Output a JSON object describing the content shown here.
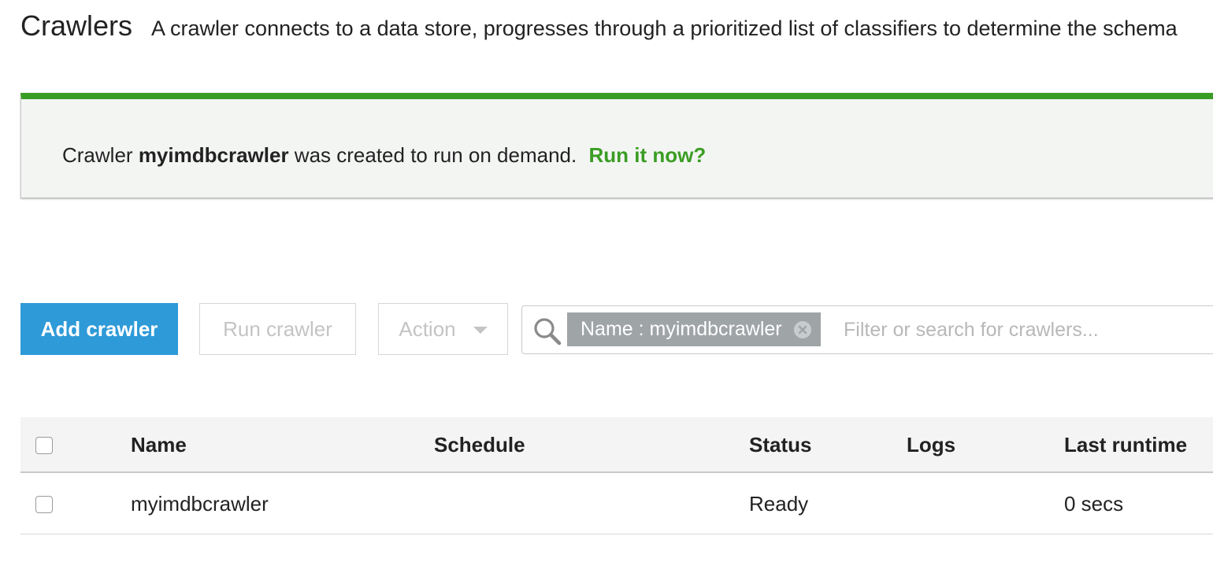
{
  "header": {
    "title": "Crawlers",
    "description": "A crawler connects to a data store, progresses through a prioritized list of classifiers to determine the schema"
  },
  "banner": {
    "prefix": "Crawler",
    "crawler_name": "myimdbcrawler",
    "suffix": "was created to run on demand.",
    "link": "Run it now?",
    "accent_color": "#3a9d23"
  },
  "toolbar": {
    "add_label": "Add crawler",
    "run_label": "Run crawler",
    "action_label": "Action"
  },
  "search": {
    "token": "Name : myimdbcrawler",
    "placeholder": "Filter or search for crawlers..."
  },
  "table": {
    "columns": [
      "Name",
      "Schedule",
      "Status",
      "Logs",
      "Last runtime"
    ],
    "rows": [
      {
        "name": "myimdbcrawler",
        "schedule": "",
        "status": "Ready",
        "logs": "",
        "last_runtime": "0 secs"
      }
    ]
  },
  "colors": {
    "primary": "#2e9ad8",
    "success": "#3a9d23",
    "link": "#2e8ed0"
  }
}
